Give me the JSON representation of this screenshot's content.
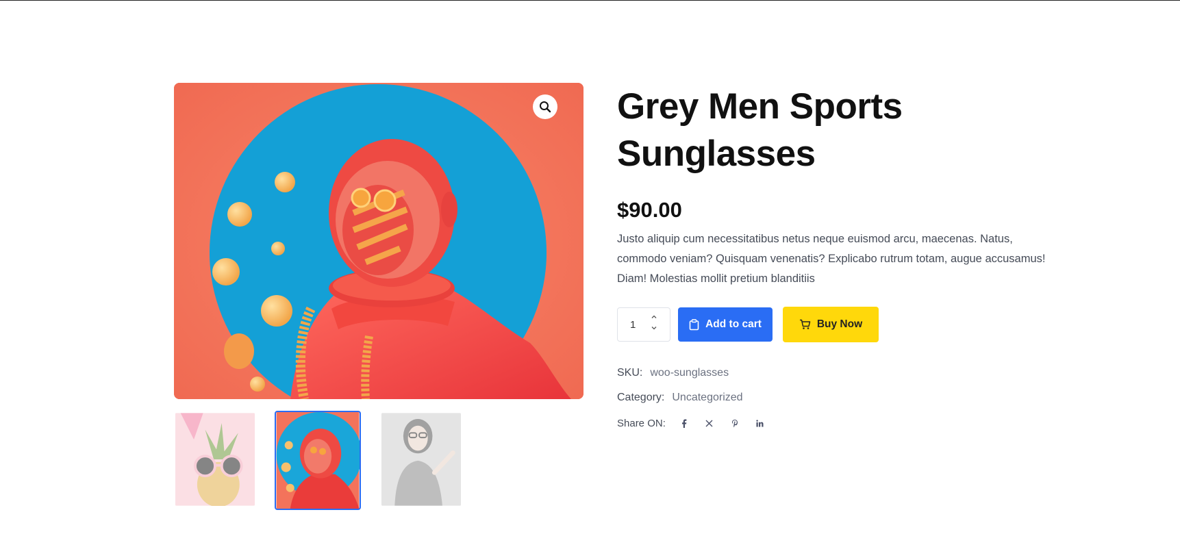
{
  "product": {
    "title_line1": "Grey Men Sports",
    "title_line2": "Sunglasses",
    "price": "$90.00",
    "description": "Justo aliquip cum necessitatibus netus neque euismod arcu, maecenas. Natus, commodo veniam? Quisquam venenatis? Explicabo rutrum totam, augue accusamus! Diam! Molestias mollit pretium blanditiis",
    "quantity": "1",
    "add_to_cart_label": "Add to cart",
    "buy_now_label": "Buy Now",
    "sku_label": "SKU:",
    "sku_value": "woo-sunglasses",
    "category_label": "Category:",
    "category_value": "Uncategorized",
    "share_label": "Share ON:"
  },
  "gallery": {
    "main_image": "astronaut-red-image",
    "zoom_icon": "magnifier-icon",
    "thumbnails": [
      {
        "name": "pineapple-sunglasses-thumb",
        "active": false
      },
      {
        "name": "astronaut-thumb",
        "active": true
      },
      {
        "name": "woman-glasses-thumb",
        "active": false
      }
    ]
  },
  "share_icons": [
    "facebook-icon",
    "x-icon",
    "pinterest-icon",
    "linkedin-icon"
  ],
  "colors": {
    "accent_blue": "#2a6df4",
    "buy_yellow": "#ffd80b",
    "image_bg_coral": "#f3735b",
    "image_circle_blue": "#1aa6d9"
  }
}
